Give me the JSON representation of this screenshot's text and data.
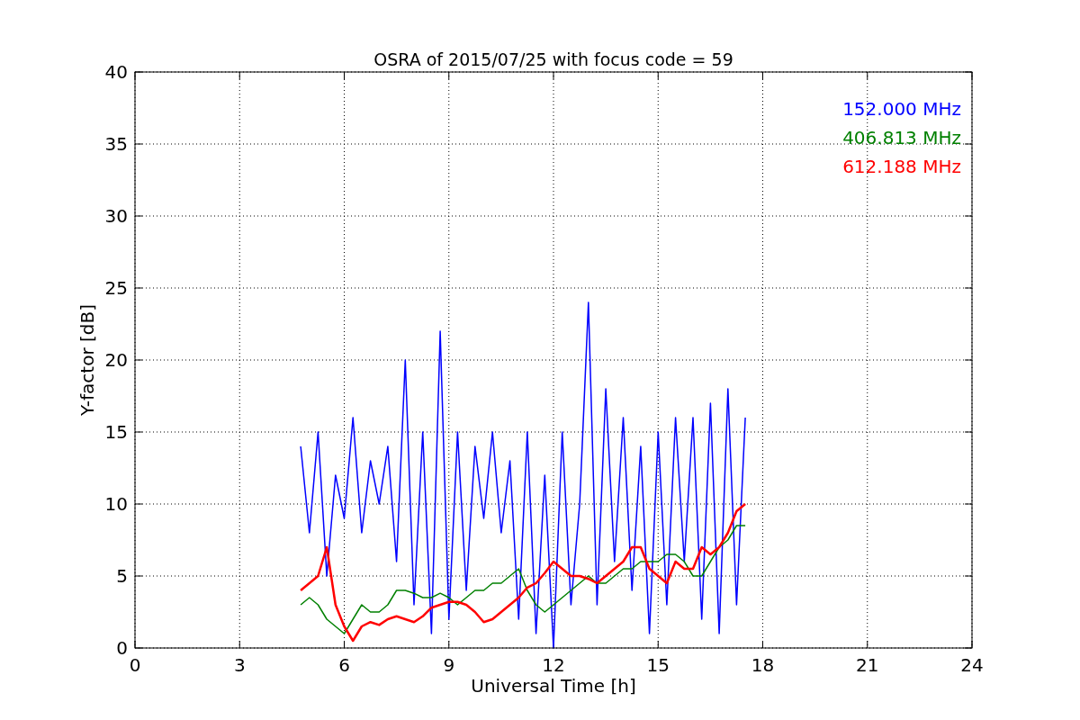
{
  "figure": {
    "chart_data": {
      "type": "line",
      "title": "OSRA of 2015/07/25 with focus code = 59",
      "xlabel": "Universal Time [h]",
      "ylabel": "Y-factor [dB]",
      "x": [
        4.75,
        5,
        5.25,
        5.5,
        5.75,
        6,
        6.25,
        6.5,
        6.75,
        7,
        7.25,
        7.5,
        7.75,
        8,
        8.25,
        8.5,
        8.75,
        9,
        9.25,
        9.5,
        9.75,
        10,
        10.25,
        10.5,
        10.75,
        11,
        11.25,
        11.5,
        11.75,
        12,
        12.25,
        12.5,
        12.75,
        13,
        13.25,
        13.5,
        13.75,
        14,
        14.25,
        14.5,
        14.75,
        15,
        15.25,
        15.5,
        15.75,
        16,
        16.25,
        16.5,
        16.75,
        17,
        17.25,
        17.5
      ],
      "series": [
        {
          "name": "152.000 MHz",
          "color": "#0000ff",
          "values": [
            14,
            8,
            15,
            5,
            12,
            9,
            16,
            8,
            13,
            10,
            14,
            6,
            20,
            3,
            15,
            1,
            22,
            2,
            15,
            4,
            14,
            9,
            15,
            8,
            13,
            2,
            15,
            1,
            12,
            0,
            15,
            3,
            10,
            24,
            3,
            18,
            6,
            16,
            4,
            14,
            1,
            15,
            3,
            16,
            6,
            16,
            2,
            17,
            1,
            18,
            3,
            16
          ]
        },
        {
          "name": "406.813 MHz",
          "color": "#008000",
          "values": [
            3,
            3.5,
            3,
            2,
            1.5,
            1,
            2,
            3,
            2.5,
            2.5,
            3,
            4,
            4,
            3.8,
            3.5,
            3.5,
            3.8,
            3.5,
            3,
            3.5,
            4,
            4,
            4.5,
            4.5,
            5,
            5.5,
            4,
            3,
            2.5,
            3,
            3.5,
            4,
            4.5,
            5,
            4.5,
            4.5,
            5,
            5.5,
            5.5,
            6,
            6,
            6,
            6.5,
            6.5,
            6,
            5,
            5,
            6,
            7,
            7.5,
            8.5,
            8.5
          ]
        },
        {
          "name": "612.188 MHz",
          "color": "#ff0000",
          "values": [
            4,
            4.5,
            5,
            7,
            3,
            1.5,
            0.5,
            1.5,
            1.8,
            1.6,
            2,
            2.2,
            2,
            1.8,
            2.2,
            2.8,
            3,
            3.2,
            3.2,
            3,
            2.5,
            1.8,
            2,
            2.5,
            3,
            3.5,
            4.2,
            4.5,
            5.2,
            6,
            5.5,
            5,
            5,
            4.8,
            4.5,
            5,
            5.5,
            6,
            7,
            7,
            5.5,
            5,
            4.5,
            6,
            5.5,
            5.5,
            7,
            6.5,
            7,
            8,
            9.5,
            10
          ]
        }
      ],
      "grid": true,
      "xlim": [
        0,
        24
      ],
      "ylim": [
        0,
        40
      ],
      "xticks": [
        0,
        3,
        6,
        9,
        12,
        15,
        18,
        21,
        24
      ],
      "yticks": [
        0,
        5,
        10,
        15,
        20,
        25,
        30,
        35,
        40
      ]
    }
  }
}
